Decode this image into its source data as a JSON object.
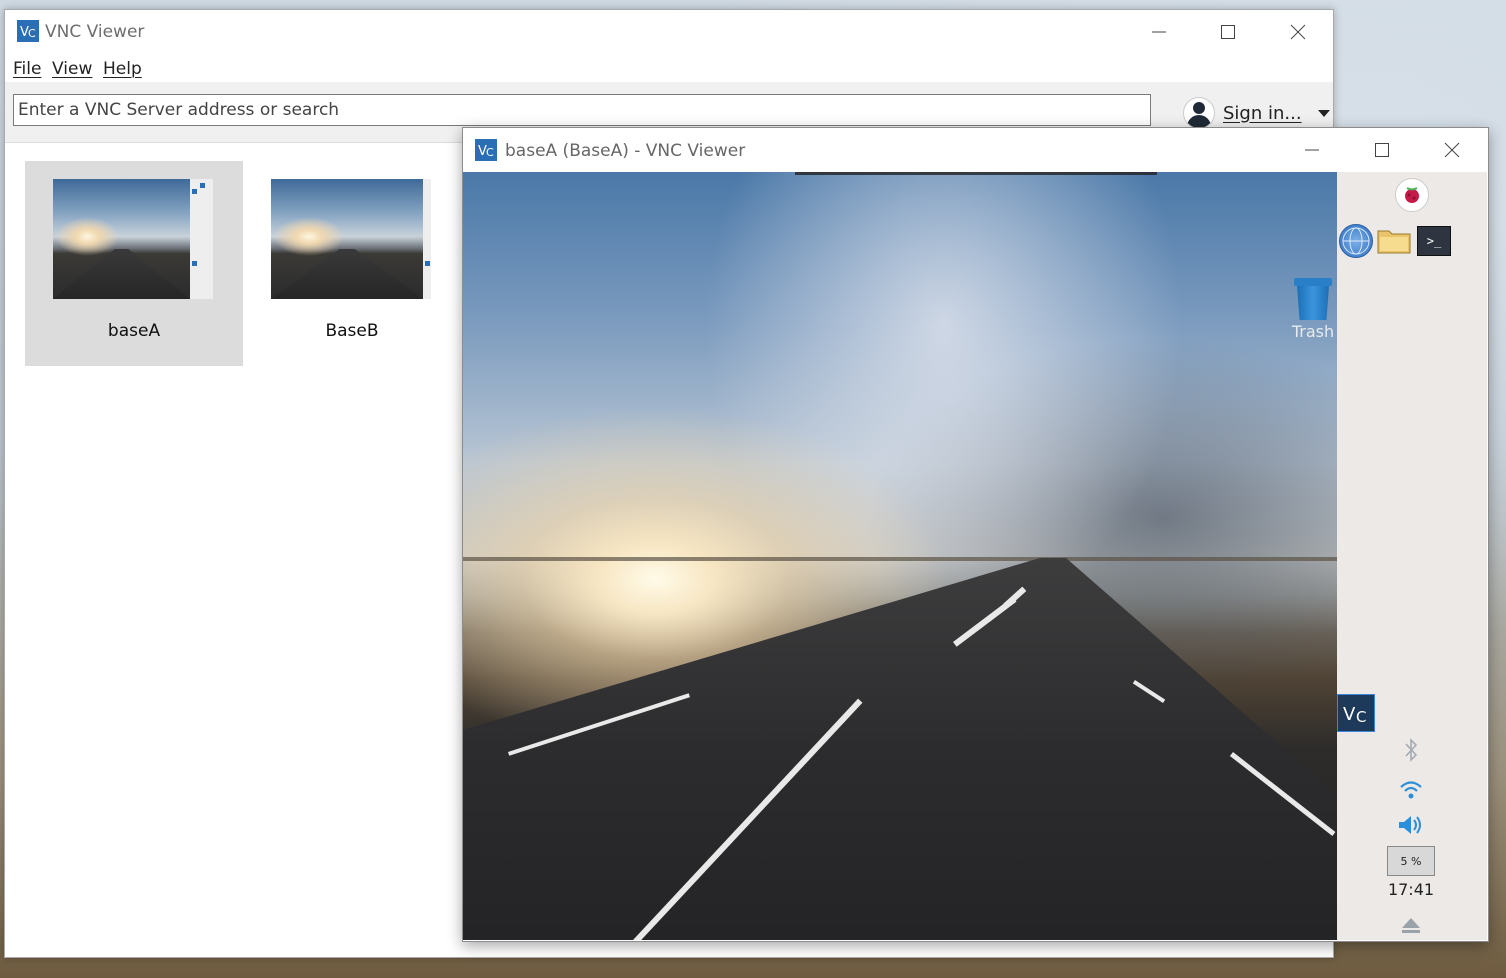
{
  "main_window": {
    "title": "VNC Viewer",
    "menu": [
      "File",
      "View",
      "Help"
    ],
    "search": {
      "placeholder": "Enter a VNC Server address or search",
      "value": ""
    },
    "signin_label": "Sign in...",
    "connections": [
      {
        "name": "baseA",
        "selected": true
      },
      {
        "name": "BaseB",
        "selected": false
      }
    ]
  },
  "session_window": {
    "title": "baseA (BaseA) - VNC Viewer",
    "desktop": {
      "trash_label": "Trash",
      "cpu_label": "5 %",
      "clock": "17:41"
    }
  },
  "colors": {
    "accent": "#2a6fb5",
    "selected_tile": "#dcdcdc",
    "panel_bg": "#ede9e6"
  }
}
